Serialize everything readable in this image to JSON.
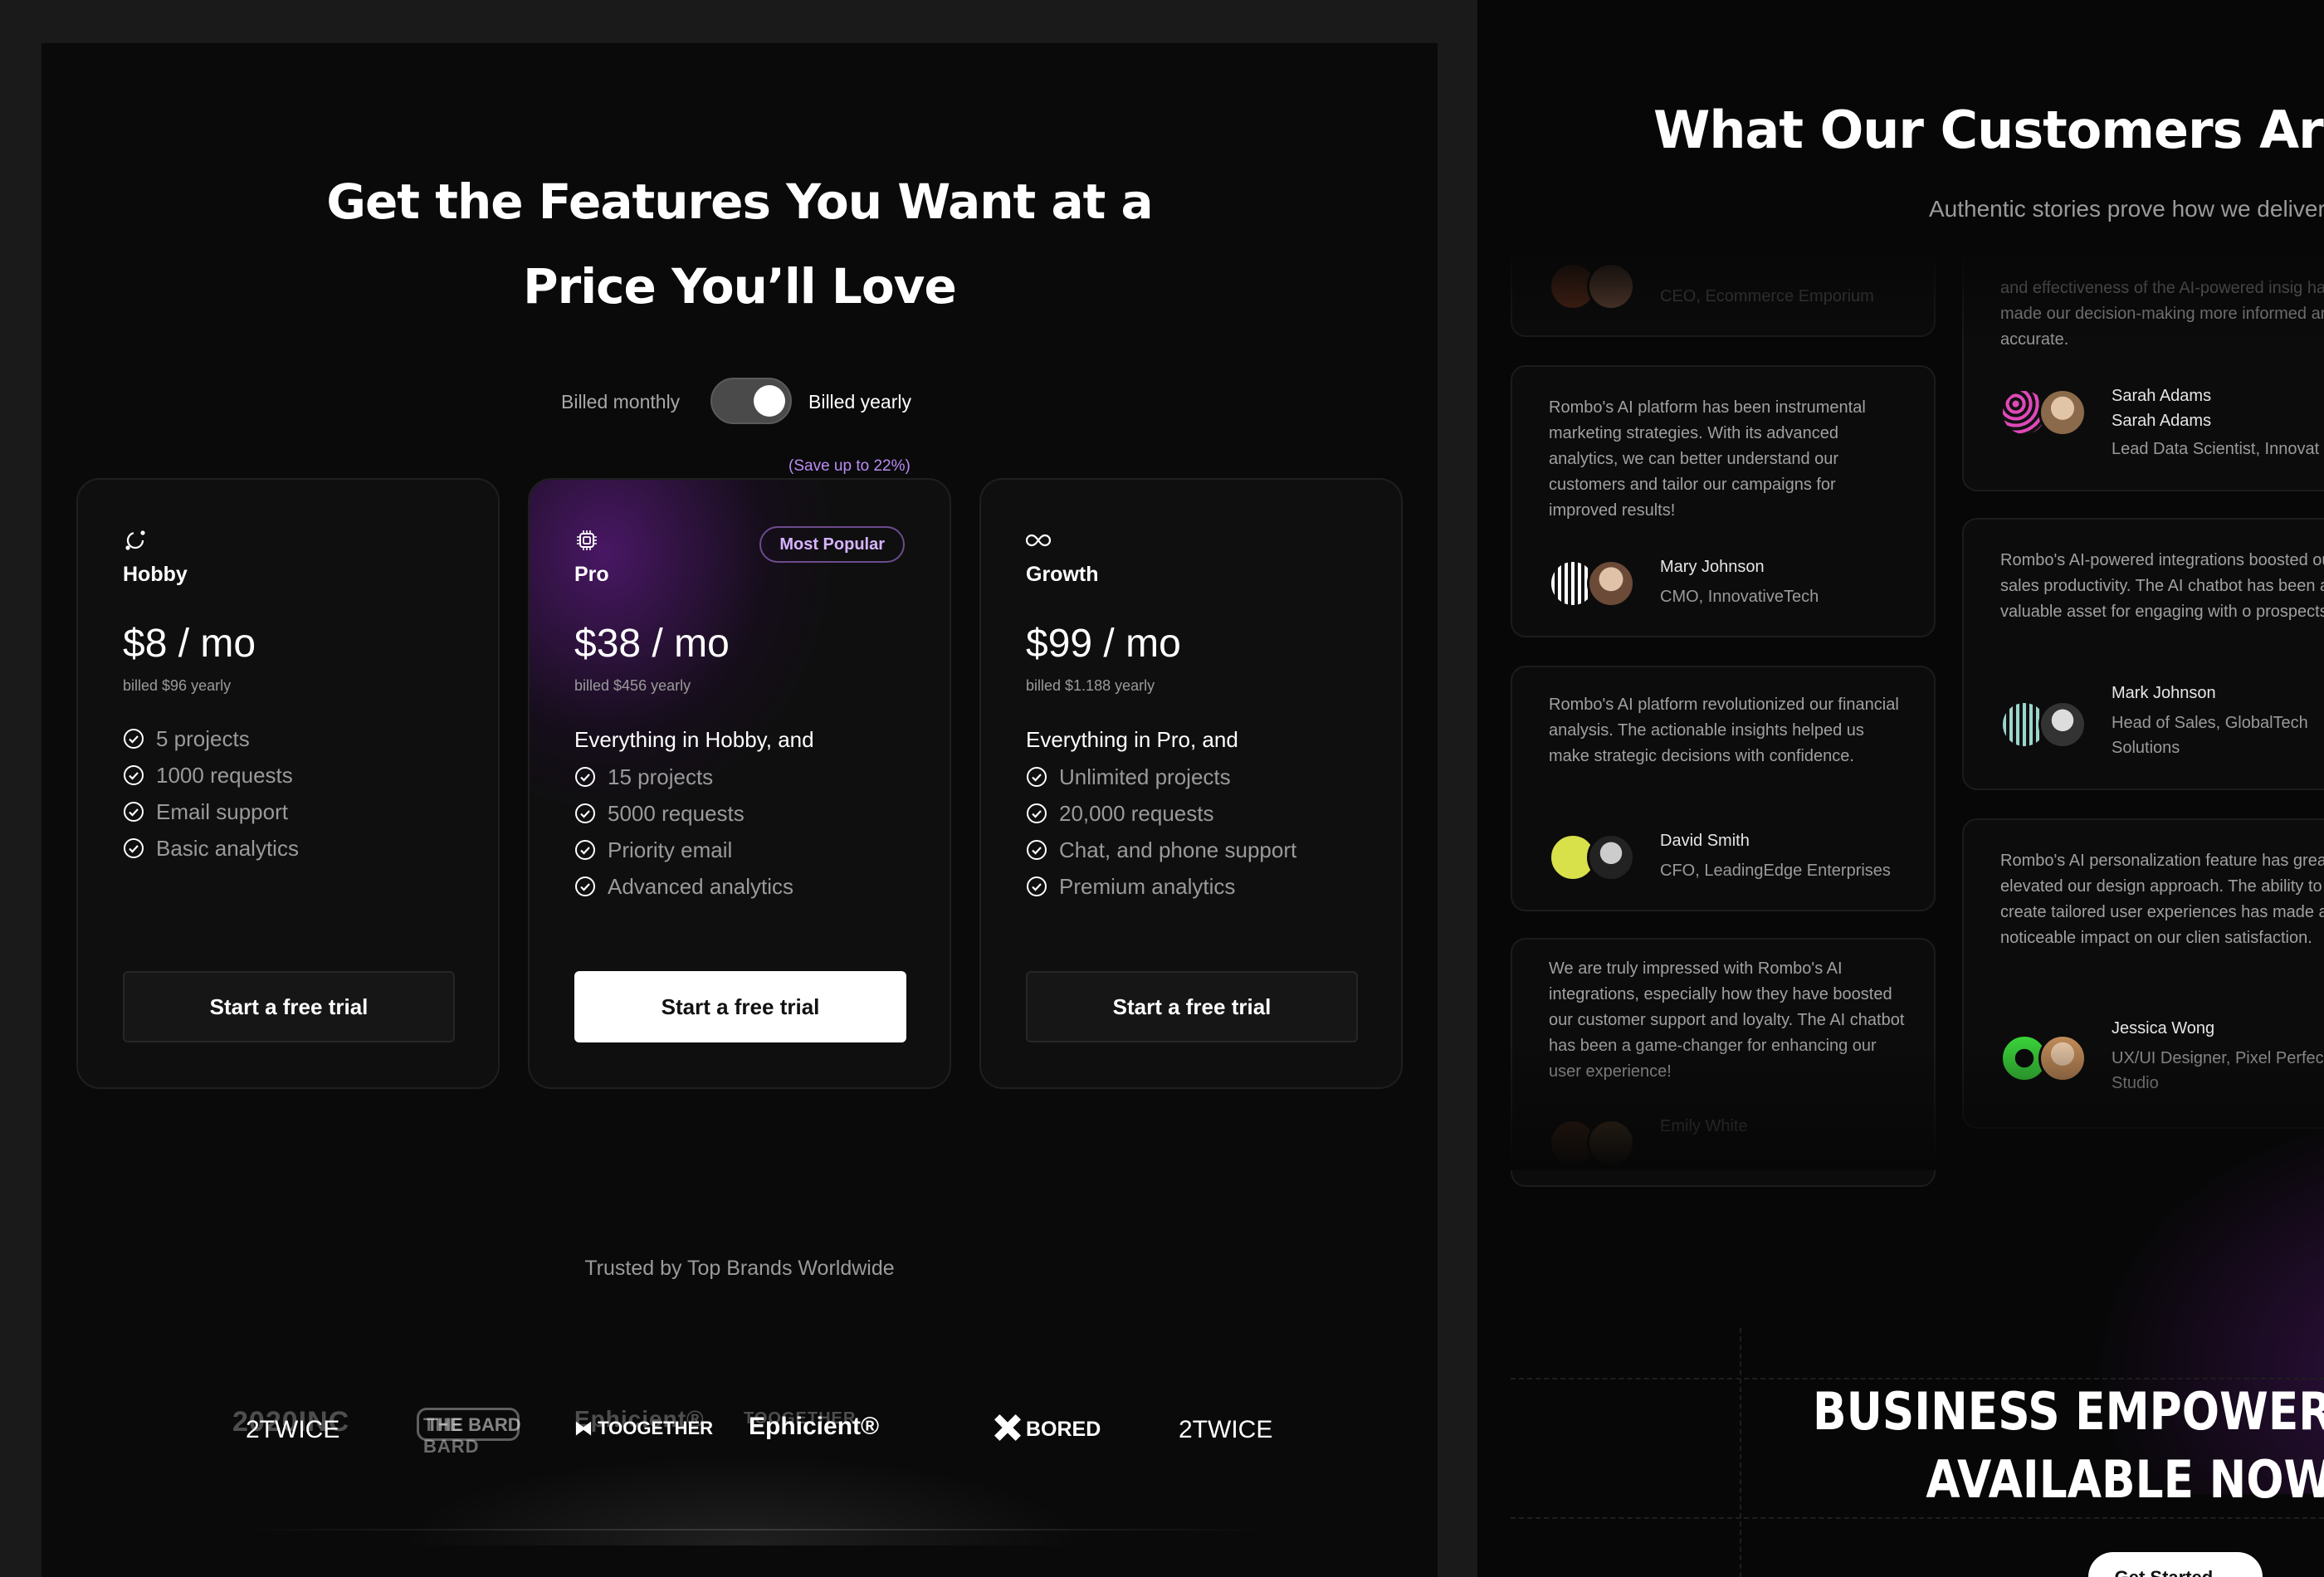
{
  "pricing": {
    "title_line1": "Get the Features You Want at a",
    "title_line2": "Price You’ll Love",
    "billing": {
      "monthly_label": "Billed monthly",
      "yearly_label": "Billed yearly",
      "save_note": "(Save up to 22%)",
      "yearly_selected": true
    },
    "plans": [
      {
        "icon": "orbit-icon",
        "name": "Hobby",
        "price": "$8 / mo",
        "billed": "billed $96 yearly",
        "lead": "",
        "features": [
          "5 projects",
          "1000 requests",
          "Email support",
          "Basic analytics"
        ],
        "cta": "Start a free trial"
      },
      {
        "icon": "chip-icon",
        "name": "Pro",
        "badge": "Most Popular",
        "price": "$38 / mo",
        "billed": "billed $456 yearly",
        "lead": "Everything in Hobby,  and",
        "features": [
          "15 projects",
          "5000 requests",
          "Priority email",
          "Advanced analytics"
        ],
        "cta": "Start a free trial"
      },
      {
        "icon": "infinity-icon",
        "name": "Growth",
        "price": "$99 / mo",
        "billed": "billed $1.188 yearly",
        "lead": "Everything in Pro,  and",
        "features": [
          "Unlimited projects",
          "20,000  requests",
          "Chat, and phone support",
          "Premium analytics"
        ],
        "cta": "Start a free trial"
      }
    ],
    "trusted_label": "Trusted by Top Brands Worldwide",
    "logos": [
      {
        "ghost": "2020INC",
        "main": "2TWICE"
      },
      {
        "ghost": "THE BARD",
        "main": "THE BARD"
      },
      {
        "ghost": "Ephicient®",
        "main": "TOOGETHER"
      },
      {
        "ghost": "TOOGETHER",
        "main": "Ephicient®"
      },
      {
        "ghost": "",
        "main": "BORED"
      },
      {
        "ghost": "",
        "main": "2TWICE"
      }
    ]
  },
  "testimonials": {
    "title": "What Our Customers Are Sa",
    "subtitle": "Authentic stories prove how we deliver f",
    "left_column": [
      {
        "quote": "",
        "name": "",
        "role": "CEO, Ecommerce Emporium"
      },
      {
        "quote": "Rombo's AI platform has been instrumental marketing strategies. With its advanced analytics, we can better understand our customers and tailor our campaigns for improved results!",
        "name": "Mary Johnson",
        "role": "CMO, InnovativeTech"
      },
      {
        "quote": "Rombo's AI platform revolutionized our financial analysis. The actionable insights helped us make strategic decisions with confidence.",
        "name": "David Smith",
        "role": "CFO, LeadingEdge Enterprises"
      },
      {
        "quote": "We are truly impressed with Rombo's AI integrations, especially how they have boosted our customer support and loyalty. The AI chatbot has been a game-changer for enhancing our user experience!",
        "name": "Emily White",
        "role": ""
      }
    ],
    "right_column": [
      {
        "quote": "and effectiveness of the AI-powered insig have made our decision-making more informed and accurate.",
        "name": "Sarah Adams",
        "role": "Lead Data Scientist, Innovat"
      },
      {
        "quote": "Rombo's AI-powered integrations boosted our sales productivity. The AI chatbot has been a valuable asset for engaging with o prospects.",
        "name": "Mark Johnson",
        "role": "Head of Sales, GlobalTech Solutions"
      },
      {
        "quote": "Rombo's AI personalization feature has greatly elevated our design approach. The ability to create tailored user experiences has made a noticeable impact on our clien satisfaction.",
        "name": "Jessica Wong",
        "role": "UX/UI Designer, Pixel Perfection Studio"
      }
    ]
  },
  "cta_section": {
    "title_line1": "BUSINESS EMPOWER",
    "title_line2": "AVAILABLE NOW",
    "button": "Get Started →"
  },
  "colors": {
    "accent_purple": "#b98cf5",
    "badge_text": "#d7b4ff",
    "panel_bg": "#0a0a0a",
    "page_bg": "#1a1a1a"
  }
}
